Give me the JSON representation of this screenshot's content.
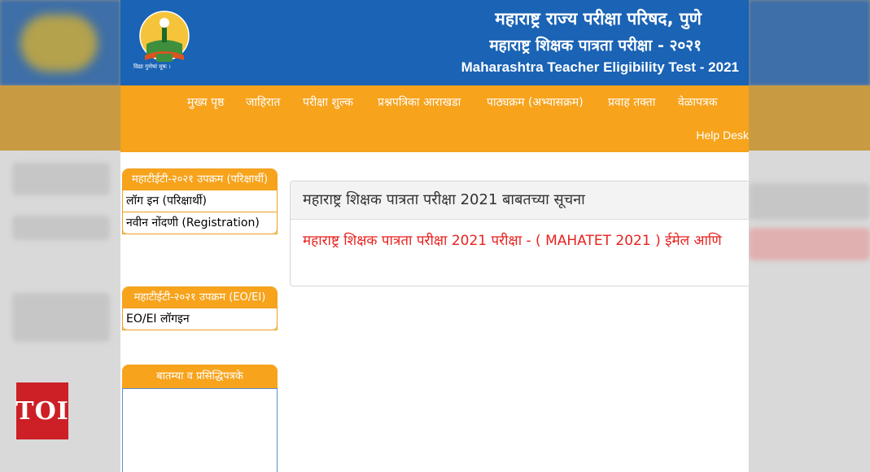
{
  "header": {
    "org_title": "महाराष्ट्र राज्य परीक्षा परिषद, पुणे",
    "exam_title_mr": "महाराष्ट्र शिक्षक पात्रता परीक्षा - २०२१",
    "exam_title_en": "Maharashtra Teacher Eligibility Test - 2021",
    "logo_top_text": "महाराष्ट्र राज्य परीक्षा परिषद",
    "logo_city": "पुणे",
    "logo_tagline": "विद्या गुणेषां मूषः ।"
  },
  "nav": {
    "items": [
      "मुख्य पृष्ठ",
      "जाहिरात",
      "परीक्षा शुल्क",
      "प्रश्नपत्रिका आराखडा",
      "पाठ्यक्रम (अभ्यासक्रम)",
      "प्रवाह तक्ता",
      "वेळापत्रक"
    ],
    "help_desk": "Help Desk"
  },
  "sidebar": {
    "candidate_panel": {
      "title": "महाटीईटी-२०२१ उपक्रम (परिक्षार्थी)",
      "links": [
        "लॉग इन (परिक्षार्थी)",
        "नवीन नोंदणी (Registration)"
      ]
    },
    "officer_panel": {
      "title": "महाटीईटी-२०२१ उपक्रम (EO/EI)",
      "links": [
        "EO/EI लॉगइन"
      ]
    },
    "news_panel": {
      "title": "बातम्या व प्रसिद्धिपत्रके"
    }
  },
  "notice": {
    "heading": "महाराष्ट्र शिक्षक पात्रता परीक्षा 2021 बाबतच्या सूचना",
    "item": "महाराष्ट्र शिक्षक पात्रता परीक्षा 2021 परीक्षा - ( MAHATET 2021 ) ईमेल आणि"
  },
  "watermark": "TOI",
  "colors": {
    "header_blue": "#1a63b5",
    "nav_orange": "#f7a31c",
    "notice_red": "#e8221f"
  }
}
